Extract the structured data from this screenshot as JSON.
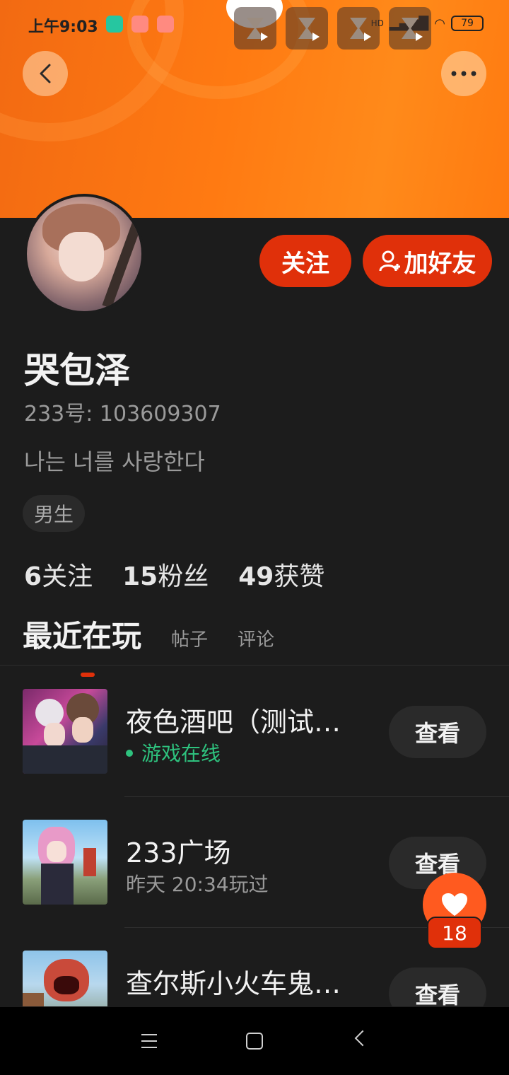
{
  "status_bar": {
    "time": "上午9:03",
    "battery": "79",
    "hd_label": "HD"
  },
  "header": {
    "back_icon": "back-icon",
    "more_icon": "more-icon"
  },
  "profile": {
    "follow_label": "关注",
    "add_friend_label": "加好友",
    "name": "哭包泽",
    "uid": "233号: 103609307",
    "bio": "나는 너를 사랑한다",
    "tag": "男生",
    "stats": [
      {
        "num": "6",
        "label": "关注"
      },
      {
        "num": "15",
        "label": "粉丝"
      },
      {
        "num": "49",
        "label": "获赞"
      }
    ]
  },
  "tabs": [
    {
      "label": "最近在玩"
    },
    {
      "label": "帖子"
    },
    {
      "label": "评论"
    }
  ],
  "games": [
    {
      "title": "夜色酒吧（测试…",
      "status": "游戏在线",
      "button": "查看"
    },
    {
      "title": "233广场",
      "status": "昨天 20:34玩过",
      "button": "查看"
    },
    {
      "title": "查尔斯小火车鬼…",
      "status": "",
      "button": "查看"
    }
  ],
  "like_fab": {
    "count": "18"
  },
  "colors": {
    "accent": "#e0300a",
    "online": "#2ec27e",
    "banner": "#ff7a12"
  }
}
